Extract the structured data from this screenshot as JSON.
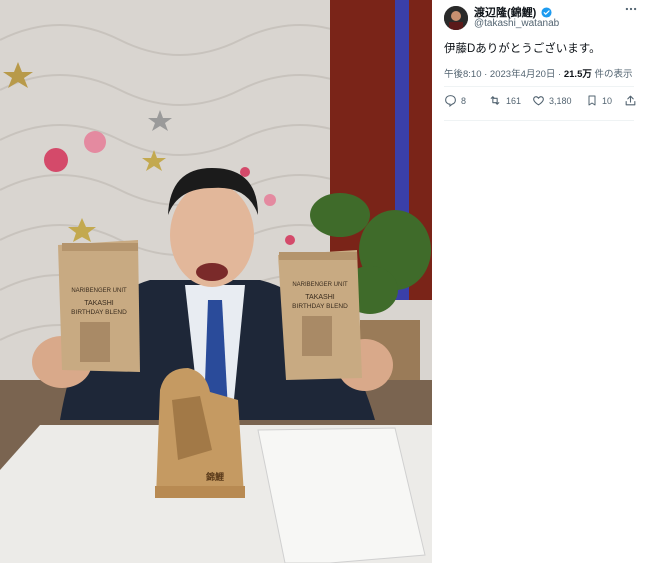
{
  "user": {
    "display_name": "渡辺隆(錦鯉)",
    "handle": "@takashi_watanab"
  },
  "tweet": {
    "text": "伊藤Dありがとうございます。",
    "time": "午後8:10 · 2023年4月20日 · ",
    "views": "21.5万",
    "views_suffix": " 件の表示"
  },
  "actions": {
    "replies": "8",
    "retweets": "161",
    "likes": "3,180",
    "bookmarks": "10"
  },
  "photo": {
    "bag_text_line1": "NARIBENGER UNIT",
    "bag_text_line2": "TAKASHI",
    "bag_text_line3": "BIRTHDAY BLEND",
    "stand_text": "錦鯉"
  },
  "icons": [
    "more-icon",
    "verified-icon",
    "reply-icon",
    "retweet-icon",
    "like-icon",
    "bookmark-icon",
    "share-icon"
  ],
  "colors": {
    "accent": "#1d9bf0",
    "muted": "#536471",
    "text": "#0f1419"
  }
}
